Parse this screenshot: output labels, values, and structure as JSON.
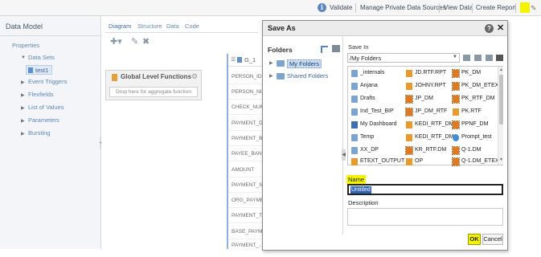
{
  "toolbar": {
    "validate": "Validate",
    "manage_private_data_sources": "Manage Private Data Sources",
    "view_data": "View Data",
    "create_report": "Create Report"
  },
  "left_panel": {
    "title": "Data Model",
    "items": [
      {
        "label": "Properties"
      },
      {
        "label": "Data Sets"
      },
      {
        "label": "test1"
      },
      {
        "label": "Event Triggers"
      },
      {
        "label": "Flexfields"
      },
      {
        "label": "List of Values"
      },
      {
        "label": "Parameters"
      },
      {
        "label": "Bursting"
      }
    ]
  },
  "editor": {
    "tabs": [
      "Diagram",
      "Structure",
      "Data",
      "Code"
    ],
    "global_level_functions": {
      "title": "Global Level Functions",
      "drop_hint": "Drop here for aggregate function"
    },
    "group": {
      "title": "G_1",
      "fields": [
        "PERSON_ID",
        "PERSON_NU",
        "CHECK_NUM",
        "PAYMENT_D",
        "PAYMENT_BANK",
        "PAYEE_BANK",
        "AMOUNT",
        "PAYMENT_S",
        "ORG_PAYME",
        "PAYMENT_T",
        "BASE_PAYM",
        "PAYMENT_..."
      ]
    }
  },
  "dialog": {
    "title": "Save As",
    "folders": {
      "title": "Folders",
      "items": [
        {
          "label": "My Folders",
          "selected": true
        },
        {
          "label": "Shared Folders",
          "selected": false
        }
      ]
    },
    "save_in": {
      "label": "Save In",
      "value": "/My Folders"
    },
    "grid": [
      {
        "label": "_internals",
        "icon": "folder"
      },
      {
        "label": "JD.RTF.RPT",
        "icon": "report"
      },
      {
        "label": "PK_DM",
        "icon": "datamodel"
      },
      {
        "label": "Anjana",
        "icon": "folder"
      },
      {
        "label": "JOHNY.RPT",
        "icon": "report"
      },
      {
        "label": "PK_DM_ETEX",
        "icon": "datamodel"
      },
      {
        "label": "Drafts",
        "icon": "folder"
      },
      {
        "label": "JP_DM",
        "icon": "datamodel"
      },
      {
        "label": "PK_RTF_DM",
        "icon": "datamodel"
      },
      {
        "label": "Ind_Test_BIP",
        "icon": "folder"
      },
      {
        "label": "JP_DM_RTF",
        "icon": "datamodel"
      },
      {
        "label": "PK.RTF",
        "icon": "report"
      },
      {
        "label": "My Dashboard",
        "icon": "dashboard"
      },
      {
        "label": "KEDI_RTF_DM",
        "icon": "report"
      },
      {
        "label": "PPNF_DM",
        "icon": "datamodel"
      },
      {
        "label": "Temp",
        "icon": "folder"
      },
      {
        "label": "KEDI_RTF_DM",
        "icon": "report"
      },
      {
        "label": "Prompt_test",
        "icon": "style"
      },
      {
        "label": "XX_DP",
        "icon": "folder"
      },
      {
        "label": "KR_RTF.DM",
        "icon": "datamodel"
      },
      {
        "label": "Q-1.DM",
        "icon": "datamodel"
      },
      {
        "label": "ETEXT_OUTPUT",
        "icon": "report"
      },
      {
        "label": "OP",
        "icon": "report"
      },
      {
        "label": "Q-1.DM_ETEX",
        "icon": "datamodel"
      }
    ],
    "name": {
      "label": "Name",
      "value": "Untitled"
    },
    "description": {
      "label": "Description",
      "value": ""
    },
    "ok_label": "OK",
    "cancel_label": "Cancel"
  },
  "colors": {
    "highlight": "#f4f400",
    "link_blue": "#5f87b5",
    "selection_blue": "#2d62b5"
  }
}
